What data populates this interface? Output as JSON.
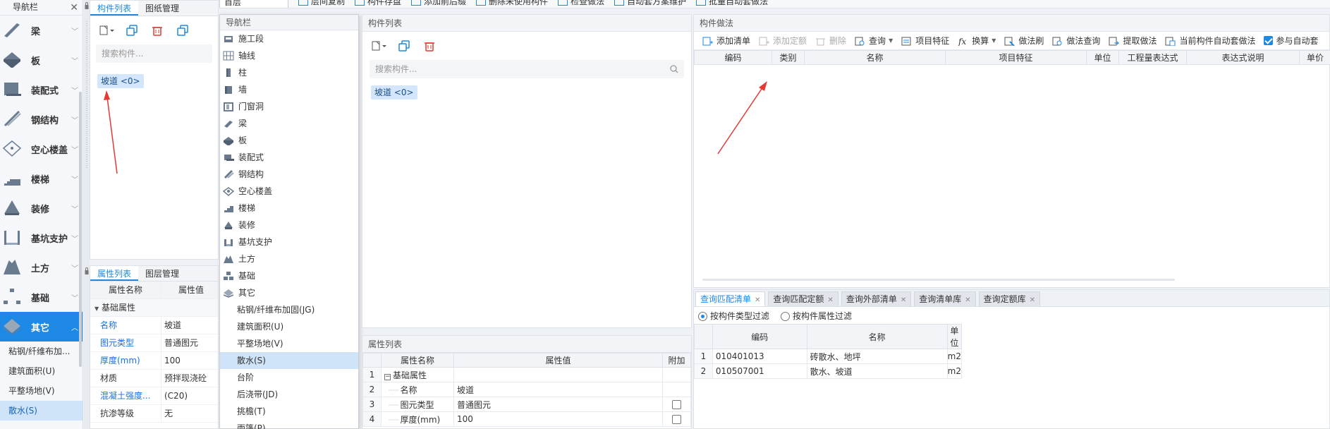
{
  "left_nav": {
    "title": "导航栏",
    "categories": [
      {
        "label": "梁",
        "icon": "beam-icon"
      },
      {
        "label": "板",
        "icon": "slab-icon"
      },
      {
        "label": "装配式",
        "icon": "prefab-icon"
      },
      {
        "label": "钢结构",
        "icon": "steel-structure-icon"
      },
      {
        "label": "空心楼盖",
        "icon": "hollow-floor-icon"
      },
      {
        "label": "楼梯",
        "icon": "stairs-icon"
      },
      {
        "label": "装修",
        "icon": "decoration-icon"
      },
      {
        "label": "基坑支护",
        "icon": "pit-support-icon"
      },
      {
        "label": "土方",
        "icon": "earthwork-icon"
      },
      {
        "label": "基础",
        "icon": "foundation-icon"
      },
      {
        "label": "其它",
        "icon": "other-icon"
      }
    ],
    "sub_items": [
      "粘钢/纤维布加...",
      "建筑面积(U)",
      "平整场地(V)",
      "散水(S)"
    ]
  },
  "panel1": {
    "tabs": [
      "构件列表",
      "图纸管理"
    ],
    "search_placeholder": "搜索构件...",
    "chip": "坡道 <0>"
  },
  "prop1": {
    "tabs": [
      "属性列表",
      "图层管理"
    ],
    "col_name": "属性名称",
    "col_value": "属性值",
    "group": "基础属性",
    "rows": [
      {
        "k": "名称",
        "v": "坡道"
      },
      {
        "k": "图元类型",
        "v": "普通图元"
      },
      {
        "k": "厚度(mm)",
        "v": "100"
      },
      {
        "k": "材质",
        "v": "预拌现浇砼"
      },
      {
        "k": "混凝土强度...",
        "v": "(C20)"
      },
      {
        "k": "抗渗等级",
        "v": "无"
      }
    ]
  },
  "top_toolbar": {
    "floor": "首层",
    "items": [
      "层间复制",
      "构件存盘",
      "添加前后缀",
      "删除未使用构件",
      "检查做法",
      "自动套方案维护",
      "批量自动套做法"
    ]
  },
  "dropdown": {
    "title": "导航栏",
    "items": [
      {
        "label": "施工段",
        "icon": "construction-section-icon"
      },
      {
        "label": "轴线",
        "icon": "axis-icon"
      },
      {
        "label": "柱",
        "icon": "column-icon"
      },
      {
        "label": "墙",
        "icon": "wall-icon"
      },
      {
        "label": "门窗洞",
        "icon": "door-window-icon"
      },
      {
        "label": "梁",
        "icon": "beam-icon"
      },
      {
        "label": "板",
        "icon": "slab-icon"
      },
      {
        "label": "装配式",
        "icon": "prefab-icon"
      },
      {
        "label": "钢结构",
        "icon": "steel-structure-icon"
      },
      {
        "label": "空心楼盖",
        "icon": "hollow-floor-icon"
      },
      {
        "label": "楼梯",
        "icon": "stairs-icon"
      },
      {
        "label": "装修",
        "icon": "decoration-icon"
      },
      {
        "label": "基坑支护",
        "icon": "pit-support-icon"
      },
      {
        "label": "土方",
        "icon": "earthwork-icon"
      },
      {
        "label": "基础",
        "icon": "foundation-icon"
      },
      {
        "label": "其它",
        "icon": "other-icon"
      }
    ],
    "sub_items": [
      "粘钢/纤维布加固(JG)",
      "建筑面积(U)",
      "平整场地(V)",
      "散水(S)",
      "台阶",
      "后浇带(JD)",
      "挑檐(T)",
      "雨篷(P)"
    ]
  },
  "panel2": {
    "title": "构件列表",
    "search_placeholder": "搜索构件...",
    "chip": "坡道 <0>"
  },
  "prop2": {
    "title": "属性列表",
    "headers": [
      "属性名称",
      "属性值",
      "附加"
    ],
    "rows": [
      {
        "idx": "1",
        "name": "基础属性",
        "value": "",
        "group": true
      },
      {
        "idx": "2",
        "name": "名称",
        "value": "坡道",
        "check": false
      },
      {
        "idx": "3",
        "name": "图元类型",
        "value": "普通图元",
        "check": true
      },
      {
        "idx": "4",
        "name": "厚度(mm)",
        "value": "100",
        "check": true
      }
    ]
  },
  "method": {
    "title": "构件做法",
    "toolbar": [
      {
        "label": "添加清单",
        "disabled": false,
        "icon": "add-list-icon"
      },
      {
        "label": "添加定额",
        "disabled": true,
        "icon": "add-quota-icon"
      },
      {
        "label": "删除",
        "disabled": true,
        "icon": "delete-icon"
      },
      {
        "label": "查询",
        "disabled": false,
        "icon": "query-icon",
        "dropdown": true
      },
      {
        "label": "项目特征",
        "disabled": false,
        "icon": "item-feature-icon"
      },
      {
        "label": "换算",
        "disabled": false,
        "icon": "formula-icon",
        "dropdown": true
      },
      {
        "label": "做法刷",
        "disabled": false,
        "icon": "method-brush-icon"
      },
      {
        "label": "做法查询",
        "disabled": false,
        "icon": "method-query-icon"
      },
      {
        "label": "提取做法",
        "disabled": false,
        "icon": "extract-method-icon"
      },
      {
        "label": "当前构件自动套做法",
        "disabled": false,
        "icon": "auto-apply-icon"
      }
    ],
    "auto_label": "参与自动套",
    "headers": [
      "编码",
      "类别",
      "名称",
      "项目特征",
      "单位",
      "工程量表达式",
      "表达式说明",
      "单价"
    ]
  },
  "query": {
    "tabs": [
      "查询匹配清单",
      "查询匹配定额",
      "查询外部清单",
      "查询清单库",
      "查询定额库"
    ],
    "filters": [
      "按构件类型过滤",
      "按构件属性过滤"
    ],
    "headers": [
      "编码",
      "名称",
      "单位"
    ],
    "rows": [
      {
        "idx": "1",
        "code": "010401013",
        "name": "砖散水、地坪",
        "unit": "m2"
      },
      {
        "idx": "2",
        "code": "010507001",
        "name": "散水、坡道",
        "unit": "m2"
      }
    ]
  },
  "colors": {
    "accent": "#1e88e5",
    "selected_bg": "#cfe3f9",
    "arrow": "#e53935"
  }
}
